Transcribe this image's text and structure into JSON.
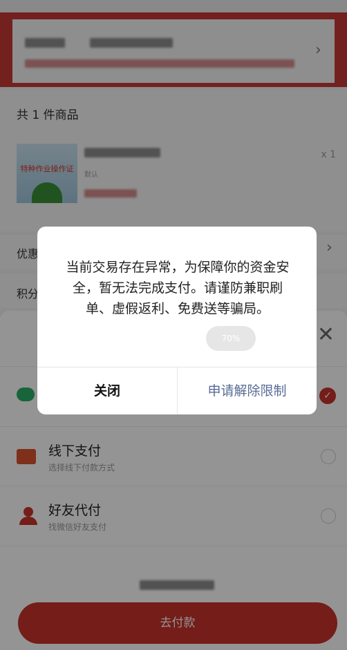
{
  "order": {
    "item_count_text": "共 1 件商品",
    "quantity": "x 1",
    "default_tag": "默认",
    "discount_label": "优惠",
    "points_label": "积分",
    "thumb_text": "特种作业操作证"
  },
  "sheet": {
    "options": [
      {
        "title": "",
        "subtitle": "",
        "icon": "wechat-pay-icon",
        "selected": true
      },
      {
        "title": "线下支付",
        "subtitle": "选择线下付款方式",
        "icon": "wallet-icon",
        "selected": false
      },
      {
        "title": "好友代付",
        "subtitle": "找微信好友支付",
        "icon": "friends-icon",
        "selected": false
      }
    ],
    "pay_button": "去付款"
  },
  "dialog": {
    "message": "当前交易存在异常，为保障你的资金安全，暂无法完成支付。请谨防兼职刷单、虚假返利、免费送等骗局。",
    "close_label": "关闭",
    "apply_label": "申请解除限制"
  },
  "toast": {
    "text": "70%"
  },
  "colors": {
    "accent": "#c8322c",
    "link": "#576b95"
  }
}
